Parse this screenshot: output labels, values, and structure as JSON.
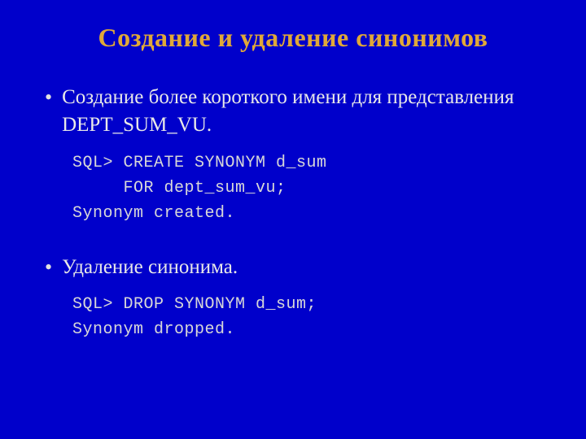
{
  "title": "Создание и удаление синонимов",
  "bullet1": "Создание более короткого имени для представления DEPT_SUM_VU.",
  "code1_line1": "SQL> CREATE SYNONYM d_sum",
  "code1_line2": "     FOR dept_sum_vu;",
  "code1_line3": "Synonym created.",
  "bullet2": "Удаление синонима.",
  "code2_line1": "SQL> DROP SYNONYM d_sum;",
  "code2_line2": "Synonym dropped."
}
